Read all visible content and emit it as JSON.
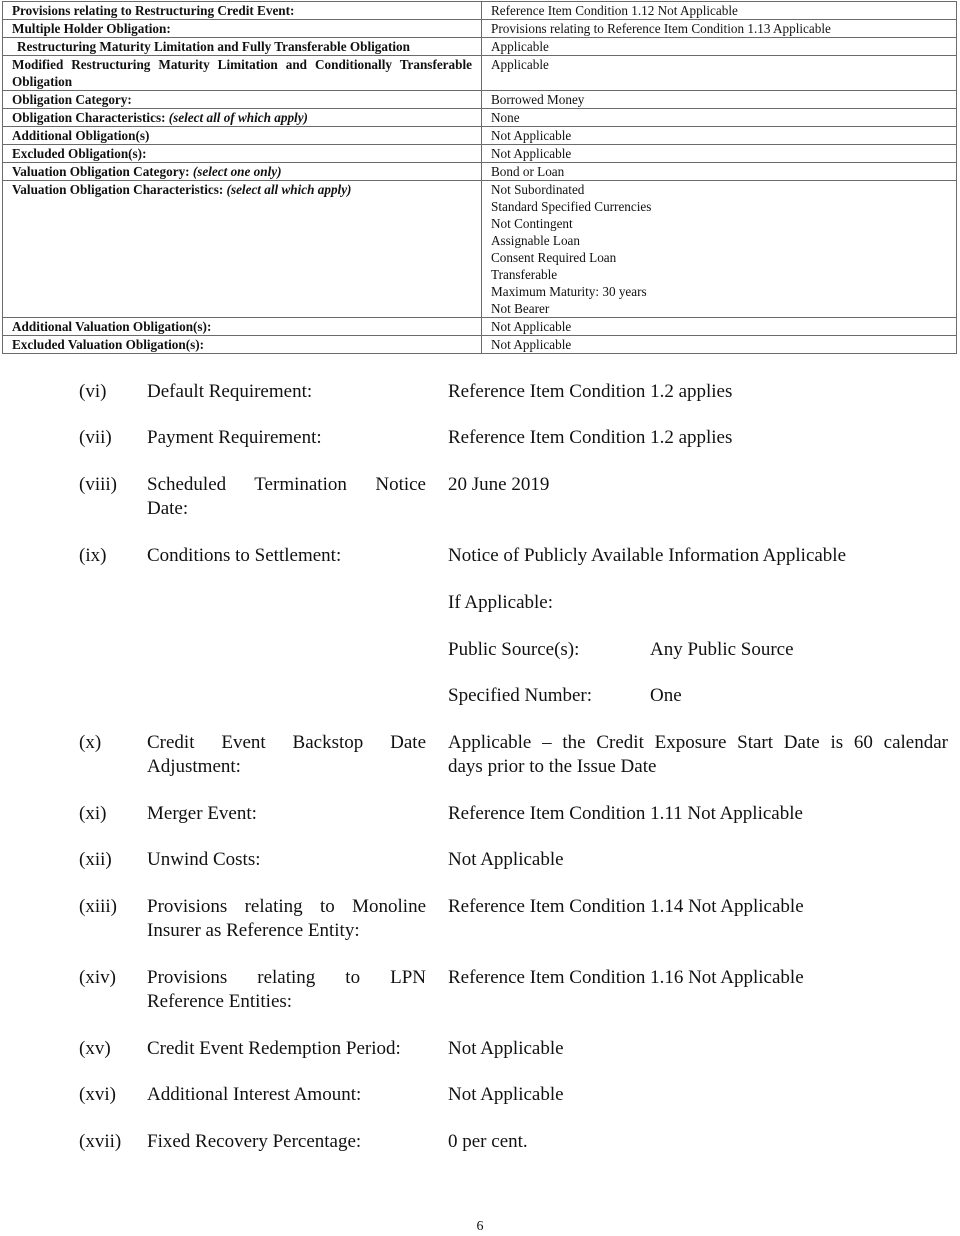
{
  "table": {
    "rows": [
      {
        "label": "Provisions relating to Restructuring Credit Event:",
        "value": "Reference Item Condition 1.12 Not Applicable"
      },
      {
        "label": "Multiple Holder Obligation:",
        "value": "Provisions relating to Reference Item Condition 1.13 Applicable"
      },
      {
        "label": "Restructuring Maturity Limitation and Fully Transferable Obligation",
        "value": "Applicable"
      },
      {
        "label": "Modified Restructuring Maturity Limitation and Conditionally Transferable Obligation",
        "value": "Applicable"
      },
      {
        "label": "Obligation Category:",
        "value": "Borrowed Money"
      },
      {
        "label": "Obligation Characteristics:",
        "label_note": "(select all of which apply)",
        "value": "None"
      },
      {
        "label": "Additional Obligation(s)",
        "value": "Not Applicable"
      },
      {
        "label": "Excluded Obligation(s):",
        "value": "Not Applicable"
      },
      {
        "label": "Valuation Obligation Category:",
        "label_note": "(select one only)",
        "value": "Bond or Loan"
      },
      {
        "label": "Valuation Obligation Characteristics:",
        "label_note": "(select all which apply)",
        "values": [
          "Not Subordinated",
          "Standard Specified Currencies",
          "Not Contingent",
          "Assignable Loan",
          "Consent Required Loan",
          "Transferable",
          "Maximum Maturity: 30 years",
          "Not Bearer"
        ]
      },
      {
        "label": "Additional Valuation Obligation(s):",
        "value": "Not Applicable"
      },
      {
        "label": "Excluded Valuation Obligation(s):",
        "value": "Not Applicable"
      }
    ]
  },
  "items": {
    "vi": {
      "num": "(vi)",
      "label": "Default Requirement:",
      "value": "Reference Item Condition 1.2 applies"
    },
    "vii": {
      "num": "(vii)",
      "label": "Payment Requirement:",
      "value": "Reference Item Condition 1.2 applies"
    },
    "viii": {
      "num": "(viii)",
      "label_line1": "Scheduled Termination Notice",
      "label_line2": "Date:",
      "value": "20 June 2019"
    },
    "ix": {
      "num": "(ix)",
      "label": "Conditions to Settlement:",
      "value": "Notice of Publicly Available Information Applicable",
      "if_applicable": "If Applicable:",
      "public_source_label": "Public Source(s):",
      "public_source_value": "Any Public Source",
      "specified_number_label": "Specified Number:",
      "specified_number_value": "One"
    },
    "x": {
      "num": "(x)",
      "label_line1": "Credit Event Backstop Date",
      "label_line2": "Adjustment:",
      "value_line1": "Applicable – the Credit Exposure Start Date is 60 calendar",
      "value_line2": "days prior to the Issue Date"
    },
    "xi": {
      "num": "(xi)",
      "label": "Merger Event:",
      "value": "Reference Item Condition 1.11 Not Applicable"
    },
    "xii": {
      "num": "(xii)",
      "label": "Unwind Costs:",
      "value": "Not Applicable"
    },
    "xiii": {
      "num": "(xiii)",
      "label_line1": "Provisions relating to Monoline",
      "label_line2": "Insurer as Reference Entity:",
      "value": "Reference Item Condition 1.14 Not Applicable"
    },
    "xiv": {
      "num": "(xiv)",
      "label_line1": "Provisions relating to LPN",
      "label_line2": "Reference Entities:",
      "value": "Reference Item Condition 1.16 Not Applicable"
    },
    "xv": {
      "num": "(xv)",
      "label": "Credit Event Redemption Period:",
      "value": "Not Applicable"
    },
    "xvi": {
      "num": "(xvi)",
      "label": "Additional Interest Amount:",
      "value": "Not Applicable"
    },
    "xvii": {
      "num": "(xvii)",
      "label": "Fixed Recovery Percentage:",
      "value": "0 per cent."
    }
  },
  "page_number": "6"
}
